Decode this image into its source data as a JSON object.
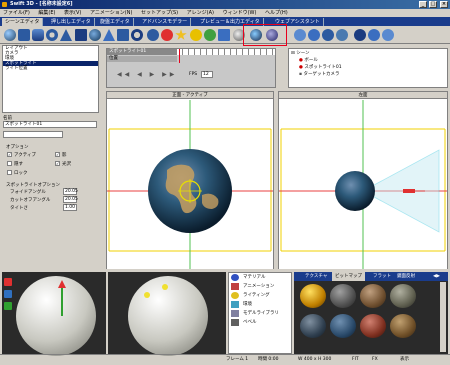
{
  "window": {
    "title": "Swift 3D - [名称未設定6]",
    "minimize": "_",
    "maximize": "□",
    "close": "×"
  },
  "menu": [
    "ファイル(F)",
    "編集(E)",
    "表示(V)",
    "アニメーション(N)",
    "セットアップ(S)",
    "アレンジ(A)",
    "ウィンドウ(W)",
    "ヘルプ(H)"
  ],
  "tabs": [
    "シーンエディタ",
    "押し出しエディタ",
    "旋盤エディタ",
    "アドバンスモデラー",
    "プレビュー＆出力エディタ",
    "ウェブアシスタント"
  ],
  "object_list": [
    "レイアウト",
    "カメラ",
    "環境",
    "スポットライト",
    "ライト位置"
  ],
  "object_list_selected": 3,
  "name_panel": {
    "label": "名前",
    "value": "スポットライト01"
  },
  "options": {
    "title": "オプション",
    "items": [
      {
        "label": "アクティブ",
        "checked": true
      },
      {
        "label": "影",
        "checked": true
      },
      {
        "label": "隠す",
        "checked": false
      },
      {
        "label": "光沢",
        "checked": true
      },
      {
        "label": "ロック",
        "checked": false
      }
    ]
  },
  "spot_options": {
    "title": "スポットライトオプション",
    "fields": [
      {
        "label": "フォイドアングル",
        "value": "20.05"
      },
      {
        "label": "カットオフアングル",
        "value": "20.05"
      },
      {
        "label": "タイトさ",
        "value": "1.00"
      }
    ]
  },
  "timeline": {
    "track_label": "スポットライト01",
    "sub_label": "位置",
    "fps_label": "FPS",
    "fps_value": "12"
  },
  "scene_tree": {
    "root": "シーン",
    "items": [
      "ボール",
      "スポットライト01",
      "ターゲットカメラ"
    ]
  },
  "viewports": {
    "front": "正面 - アクティブ",
    "left": "左面"
  },
  "library": {
    "categories": [
      "マテリアル",
      "アニメーション",
      "ライティング",
      "環境",
      "モデルライブラリ",
      "ベベル"
    ],
    "tabs": [
      "テクスチャ",
      "ビットマップ",
      "フラット",
      "鏡面反射"
    ],
    "active_tab": 1
  },
  "status": {
    "frame": "フレーム 1",
    "time": "時間 0:00",
    "size": "W 400 x H 300",
    "mode": "FIT",
    "flag": "FX",
    "bar": "表示"
  },
  "colors": {
    "accent": "#0a246a",
    "highlight": "#e8001c"
  }
}
